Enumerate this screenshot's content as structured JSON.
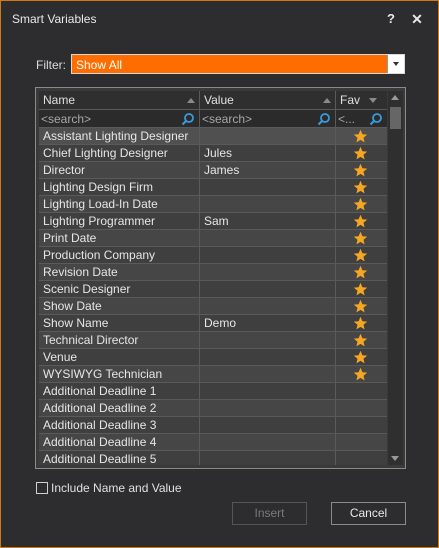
{
  "window": {
    "title": "Smart Variables",
    "help_label": "?",
    "close_label": "✕",
    "accent": "#d07a12"
  },
  "filter": {
    "label": "Filter:",
    "selected": "Show All",
    "color": "#ff6d00",
    "icon": "dropdown-arrow-icon"
  },
  "table": {
    "columns": [
      {
        "label": "Name"
      },
      {
        "label": "Value"
      },
      {
        "label": "Fav"
      }
    ],
    "search_placeholders": [
      "<search>",
      "<search>",
      "<..."
    ],
    "search_icon": "magnifier-icon",
    "fav_icon": "star-icon",
    "fav_color": "#f5a623",
    "rows": [
      {
        "name": "Assistant Lighting Designer",
        "value": "",
        "fav": true
      },
      {
        "name": "Chief Lighting Designer",
        "value": "Jules",
        "fav": true
      },
      {
        "name": "Director",
        "value": "James",
        "fav": true
      },
      {
        "name": "Lighting Design Firm",
        "value": "",
        "fav": true
      },
      {
        "name": "Lighting Load-In Date",
        "value": "",
        "fav": true
      },
      {
        "name": "Lighting Programmer",
        "value": "Sam",
        "fav": true
      },
      {
        "name": "Print Date",
        "value": "",
        "fav": true
      },
      {
        "name": "Production Company",
        "value": "",
        "fav": true
      },
      {
        "name": "Revision Date",
        "value": "",
        "fav": true
      },
      {
        "name": "Scenic Designer",
        "value": "",
        "fav": true
      },
      {
        "name": "Show Date",
        "value": "",
        "fav": true
      },
      {
        "name": "Show Name",
        "value": "Demo",
        "fav": true
      },
      {
        "name": "Technical Director",
        "value": "",
        "fav": true
      },
      {
        "name": "Venue",
        "value": "",
        "fav": true
      },
      {
        "name": "WYSIWYG Technician",
        "value": "",
        "fav": true
      },
      {
        "name": "Additional Deadline 1",
        "value": "",
        "fav": false
      },
      {
        "name": "Additional Deadline 2",
        "value": "",
        "fav": false
      },
      {
        "name": "Additional Deadline 3",
        "value": "",
        "fav": false
      },
      {
        "name": "Additional Deadline 4",
        "value": "",
        "fav": false
      },
      {
        "name": "Additional Deadline 5",
        "value": "",
        "fav": false
      }
    ]
  },
  "options": {
    "include_label": "Include Name and Value",
    "include_checked": false
  },
  "buttons": {
    "insert": "Insert",
    "cancel": "Cancel"
  }
}
